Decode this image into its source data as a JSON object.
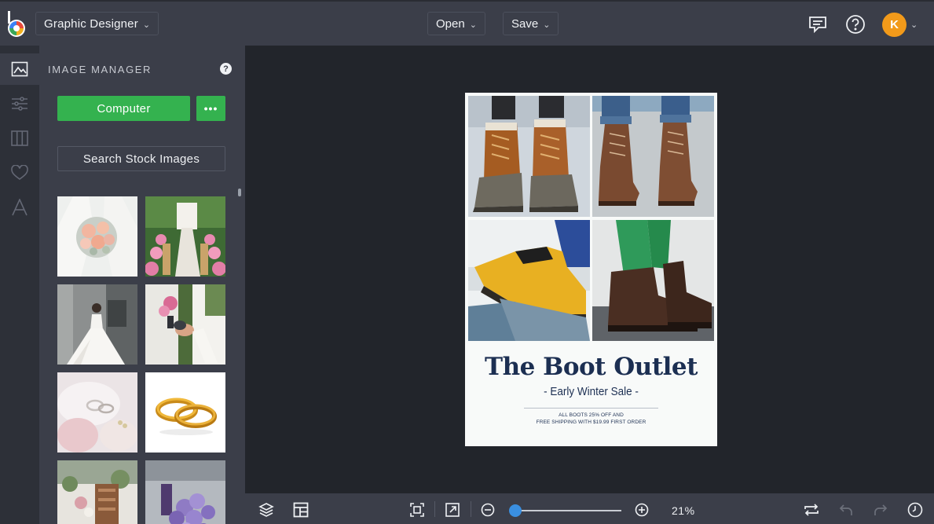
{
  "header": {
    "app_name": "Graphic Designer",
    "open_label": "Open",
    "save_label": "Save",
    "avatar_initial": "K"
  },
  "rail": {
    "items": [
      "image-icon",
      "sliders-icon",
      "layout-columns-icon",
      "heart-icon",
      "text-icon"
    ],
    "active": "image-icon"
  },
  "panel": {
    "title": "IMAGE MANAGER",
    "help_label": "?",
    "computer_button": "Computer",
    "more_button": "•••",
    "stock_button": "Search Stock Images",
    "thumbnails": [
      "bridal-bouquet",
      "wedding-aisle",
      "bride-portrait",
      "couple-holding-hands",
      "ring-dish",
      "gold-rings",
      "reception-table",
      "purple-bouquet"
    ]
  },
  "poster": {
    "title": "The Boot Outlet",
    "subtitle": "- Early Winter Sale -",
    "fine_line_1": "ALL BOOTS 25% OFF AND",
    "fine_line_2": "FREE SHIPPING WITH $19.99 FIRST ORDER",
    "photos": [
      "lace-up-duck-boots",
      "brown-leather-boots",
      "yellow-work-boot",
      "dark-brown-boots"
    ]
  },
  "bottom_bar": {
    "zoom_label": "21%",
    "zoom_value": 21
  },
  "colors": {
    "accent_green": "#34b24f",
    "avatar_orange": "#f29a1a",
    "slider_blue": "#3a8fe0",
    "poster_navy": "#1c2f52"
  }
}
